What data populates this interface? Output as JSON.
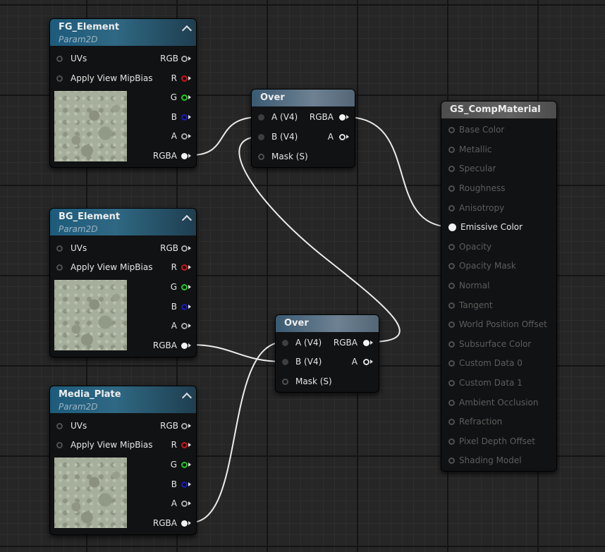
{
  "nodes": {
    "fg": {
      "title": "FG_Element",
      "subtitle": "Param2D",
      "inputs": [
        "UVs",
        "Apply View MipBias"
      ],
      "outputs": [
        "RGB",
        "R",
        "G",
        "B",
        "A",
        "RGBA"
      ]
    },
    "bg": {
      "title": "BG_Element",
      "subtitle": "Param2D",
      "inputs": [
        "UVs",
        "Apply View MipBias"
      ],
      "outputs": [
        "RGB",
        "R",
        "G",
        "B",
        "A",
        "RGBA"
      ]
    },
    "media": {
      "title": "Media_Plate",
      "subtitle": "Param2D",
      "inputs": [
        "UVs",
        "Apply View MipBias"
      ],
      "outputs": [
        "RGB",
        "R",
        "G",
        "B",
        "A",
        "RGBA"
      ]
    },
    "over1": {
      "title": "Over",
      "inputs": [
        "A (V4)",
        "B (V4)",
        "Mask (S)"
      ],
      "outputs": [
        "RGBA",
        "A"
      ]
    },
    "over2": {
      "title": "Over",
      "inputs": [
        "A (V4)",
        "B (V4)",
        "Mask (S)"
      ],
      "outputs": [
        "RGBA",
        "A"
      ]
    },
    "material": {
      "title": "GS_CompMaterial",
      "inputs": [
        "Base Color",
        "Metallic",
        "Specular",
        "Roughness",
        "Anisotropy",
        "Emissive Color",
        "Opacity",
        "Opacity Mask",
        "Normal",
        "Tangent",
        "World Position Offset",
        "Subsurface Color",
        "Custom Data 0",
        "Custom Data 1",
        "Ambient Occlusion",
        "Refraction",
        "Pixel Depth Offset",
        "Shading Model"
      ],
      "active_input": "Emissive Color"
    }
  },
  "colors": {
    "pin_white": "#f2f2f2",
    "pin_red": "#c8161b",
    "pin_green": "#1fcc1f",
    "pin_blue": "#1a1ab8",
    "pin_grey": "#a8a8a8",
    "wire": "#ececec"
  }
}
